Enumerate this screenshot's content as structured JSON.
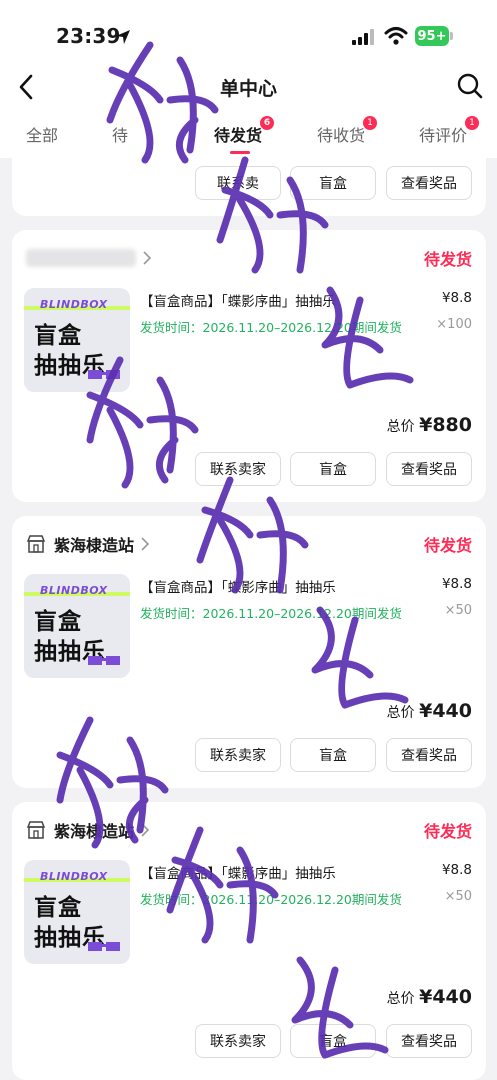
{
  "status_bar": {
    "time": "23:39",
    "battery": "95+"
  },
  "nav": {
    "title": "单中心"
  },
  "tabs": [
    {
      "label": "全部",
      "badge": ""
    },
    {
      "label": "待",
      "badge": ""
    },
    {
      "label": "待发货",
      "badge": "6"
    },
    {
      "label": "待收货",
      "badge": "1"
    },
    {
      "label": "待评价",
      "badge": "1"
    }
  ],
  "buttons": {
    "contact": "联系卖家",
    "blindbox": "盲盒",
    "view_prize": "查看奖品"
  },
  "top_card": {
    "contact": "联系卖",
    "blindbox": "盲盒",
    "view_prize": "查看奖品"
  },
  "thumbnail": {
    "brand": "BLINDBOX",
    "line1": "盲盒",
    "line2": "抽抽乐"
  },
  "orders": [
    {
      "shop_name": "",
      "status": "待发货",
      "title": "【盲盒商品】「蝶影序曲」抽抽乐",
      "price": "¥8.8",
      "ship_time": "发货时间：2026.11.20–2026.12.20期间发货",
      "quantity": "×100",
      "total_label": "总价",
      "total_amount": "¥880"
    },
    {
      "shop_name": "紫海棣造站",
      "status": "待发货",
      "title": "【盲盒商品】「蝶影序曲」抽抽乐",
      "price": "¥8.8",
      "ship_time": "发货时间：2026.11.20–2026.12.20期间发货",
      "quantity": "×50",
      "total_label": "总价",
      "total_amount": "¥440"
    },
    {
      "shop_name": "紫海棣造站",
      "status": "待发货",
      "title": "【盲盒商品】「蝶影序曲」抽抽乐",
      "price": "¥8.8",
      "ship_time": "发货时间：2026.11.20–2026.12.20期间发货",
      "quantity": "×50",
      "total_label": "总价",
      "total_amount": "¥440"
    }
  ],
  "colors": {
    "accent": "#fe2c55",
    "ship_green": "#22b35e",
    "watermark": "#5a2fb0"
  }
}
